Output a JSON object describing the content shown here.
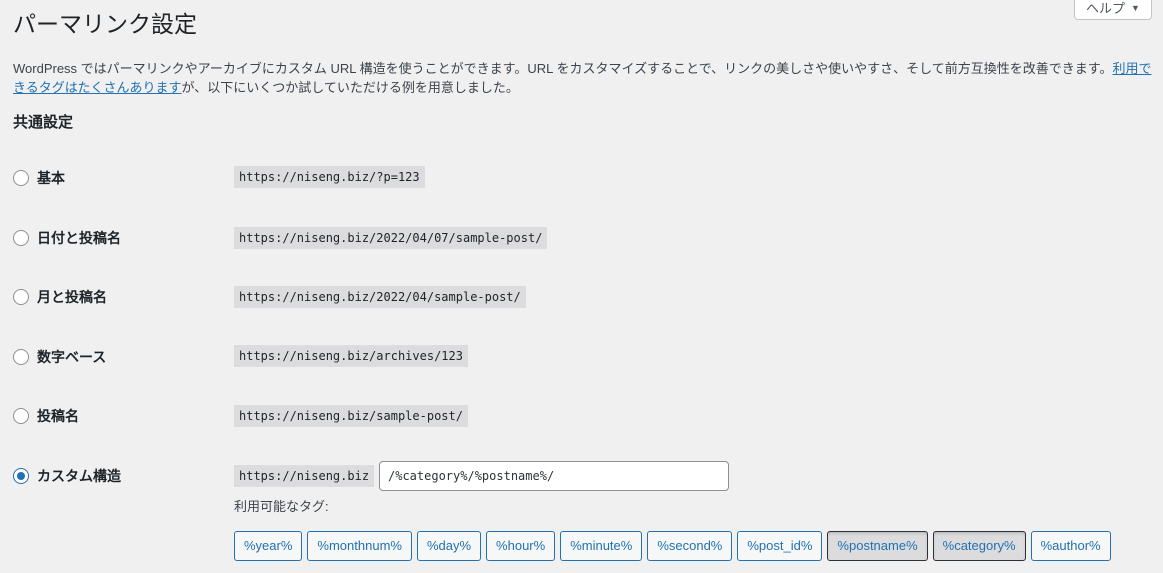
{
  "help_tab": {
    "label": "ヘルプ",
    "caret": "▼"
  },
  "page_title": "パーマリンク設定",
  "intro": {
    "text_before": "WordPress ではパーマリンクやアーカイブにカスタム URL 構造を使うことができます。URL をカスタマイズすることで、リンクの美しさや使いやすさ、そして前方互換性を改善できます。",
    "link_text": "利用できるタグはたくさんあります",
    "text_after": "が、以下にいくつか試していただける例を用意しました。"
  },
  "section_title": "共通設定",
  "options": [
    {
      "label": "基本",
      "example": "https://niseng.biz/?p=123",
      "checked": false
    },
    {
      "label": "日付と投稿名",
      "example": "https://niseng.biz/2022/04/07/sample-post/",
      "checked": false
    },
    {
      "label": "月と投稿名",
      "example": "https://niseng.biz/2022/04/sample-post/",
      "checked": false
    },
    {
      "label": "数字ベース",
      "example": "https://niseng.biz/archives/123",
      "checked": false
    },
    {
      "label": "投稿名",
      "example": "https://niseng.biz/sample-post/",
      "checked": false
    },
    {
      "label": "カスタム構造",
      "example": "https://niseng.biz",
      "checked": true
    }
  ],
  "custom_structure": {
    "value": "/%category%/%postname%/"
  },
  "available_tags": {
    "label": "利用可能なタグ:",
    "tags": [
      {
        "label": "%year%",
        "active": false
      },
      {
        "label": "%monthnum%",
        "active": false
      },
      {
        "label": "%day%",
        "active": false
      },
      {
        "label": "%hour%",
        "active": false
      },
      {
        "label": "%minute%",
        "active": false
      },
      {
        "label": "%second%",
        "active": false
      },
      {
        "label": "%post_id%",
        "active": false
      },
      {
        "label": "%postname%",
        "active": true
      },
      {
        "label": "%category%",
        "active": true
      },
      {
        "label": "%author%",
        "active": false
      }
    ]
  },
  "colors": {
    "link": "#2271b1",
    "code_bg": "#dcdcde",
    "page_bg": "#f0f0f1",
    "radio_checked": "#2271b1"
  }
}
